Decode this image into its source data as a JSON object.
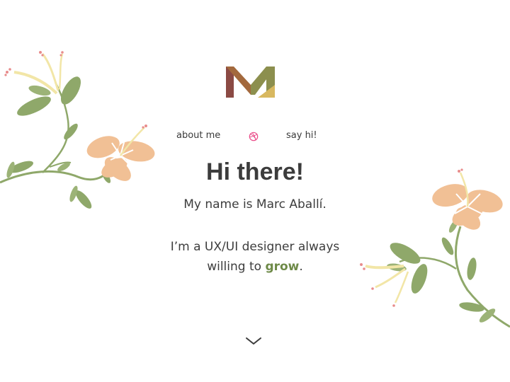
{
  "logo": {
    "label": "MA",
    "colors": [
      "#8b4a44",
      "#a3693d",
      "#8c8f4e",
      "#d8b860"
    ]
  },
  "nav": {
    "about_label": "about me",
    "say_hi_label": "say hi!",
    "dribbble_icon": "dribbble-icon"
  },
  "hero": {
    "headline": "Hi there!",
    "intro": "My name is Marc Aballí.",
    "tagline_line1": "I’m a UX/UI designer always",
    "tagline_line2_prefix": "willing to ",
    "tagline_highlight": "grow",
    "tagline_line2_suffix": "."
  },
  "scroll": {
    "icon": "chevron-down-icon"
  },
  "colors": {
    "text": "#3c3c3c",
    "accent_green": "#6e8a48",
    "leaf_green": "#8fa86a",
    "petal_peach": "#f1c095",
    "stamen_cream": "#f2e6a7",
    "dribbble_pink": "#ea4c89"
  }
}
